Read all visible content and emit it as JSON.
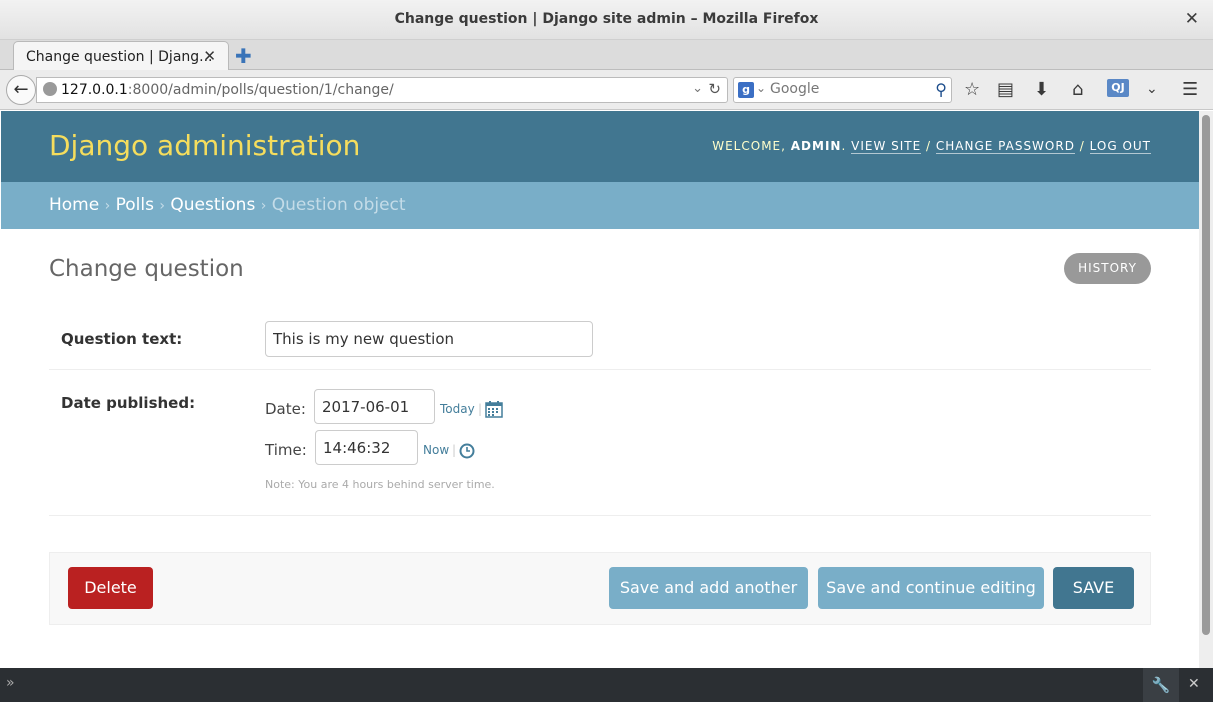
{
  "window": {
    "title": "Change question | Django site admin – Mozilla Firefox",
    "close_glyph": "✕"
  },
  "tabs": {
    "active_label": "Change question | Djang...",
    "close_glyph": "✕",
    "new_tab_glyph": "✚"
  },
  "navbar": {
    "url_host": "127.0.0.1",
    "url_rest": ":8000/admin/polls/question/1/change/",
    "search_placeholder": "Google",
    "search_engine_glyph": "g",
    "qj_label": "QJ"
  },
  "django": {
    "brand": "Django administration",
    "welcome": "WELCOME, ",
    "user": "ADMIN",
    "view_site": "VIEW SITE",
    "change_password": "CHANGE PASSWORD",
    "log_out": "LOG OUT",
    "sep": " / "
  },
  "breadcrumbs": {
    "home": "Home",
    "polls": "Polls",
    "questions": "Questions",
    "current": "Question object",
    "sep": "›"
  },
  "form": {
    "title": "Change question",
    "history": "HISTORY",
    "question_text_label": "Question text:",
    "question_text_value": "This is my new question",
    "date_published_label": "Date published:",
    "date_label": "Date:",
    "date_value": "2017-06-01",
    "today": "Today",
    "time_label": "Time:",
    "time_value": "14:46:32",
    "now": "Now",
    "pipe": "|",
    "note": "Note: You are 4 hours behind server time."
  },
  "submit": {
    "delete": "Delete",
    "save_add_another": "Save and add another",
    "save_continue": "Save and continue editing",
    "save": "SAVE"
  },
  "colors": {
    "header": "#417690",
    "breadcrumbs": "#79aec8",
    "brand": "#f5dd5d",
    "delete": "#ba2121"
  }
}
